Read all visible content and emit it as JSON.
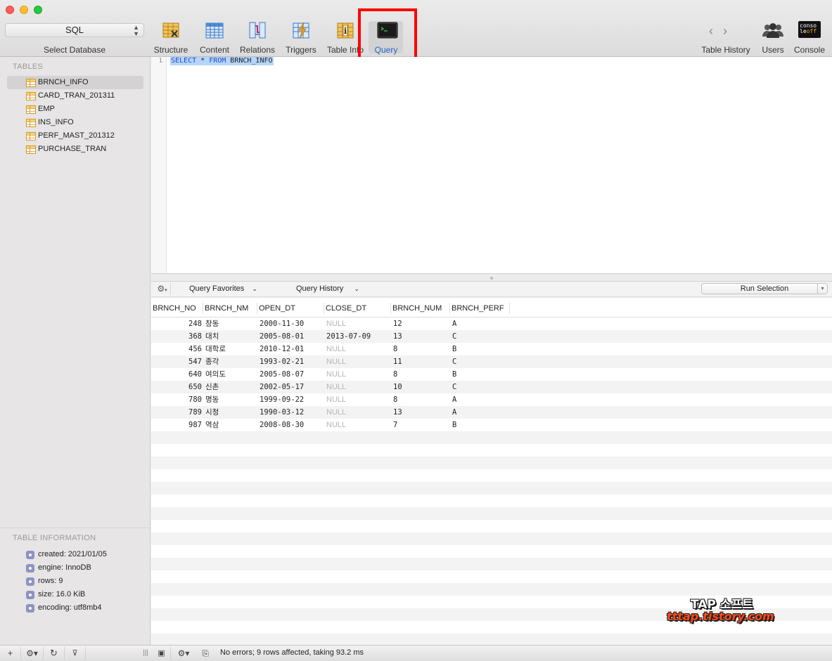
{
  "toolbar": {
    "database": {
      "value": "SQL",
      "label": "Select Database"
    },
    "buttons": {
      "structure": "Structure",
      "content": "Content",
      "relations": "Relations",
      "triggers": "Triggers",
      "table_info": "Table Info",
      "query": "Query",
      "table_history": "Table History",
      "users": "Users",
      "console": "Console"
    },
    "active": "query",
    "console_icon_text": [
      "conso",
      "le",
      "off"
    ]
  },
  "sidebar": {
    "tables_title": "TABLES",
    "tables": [
      {
        "name": "BRNCH_INFO",
        "selected": true
      },
      {
        "name": "CARD_TRAN_201311"
      },
      {
        "name": "EMP"
      },
      {
        "name": "INS_INFO"
      },
      {
        "name": "PERF_MAST_201312"
      },
      {
        "name": "PURCHASE_TRAN"
      }
    ],
    "info_title": "TABLE INFORMATION",
    "info": [
      "created: 2021/01/05",
      "engine: InnoDB",
      "rows: 9",
      "size: 16.0 KiB",
      "encoding: utf8mb4"
    ]
  },
  "editor": {
    "line_number": "1",
    "query": {
      "select": "SELECT",
      "star": " * ",
      "from": "FROM",
      "table": " BRNCH_INFO"
    }
  },
  "query_bar": {
    "favorites": "Query Favorites",
    "history": "Query History",
    "run": "Run Selection"
  },
  "results": {
    "columns": [
      "BRNCH_NO",
      "BRNCH_NM",
      "OPEN_DT",
      "CLOSE_DT",
      "BRNCH_NUM",
      "BRNCH_PERF"
    ],
    "rows": [
      [
        "248",
        "창동",
        "2000-11-30",
        "NULL",
        "12",
        "A"
      ],
      [
        "368",
        "대치",
        "2005-08-01",
        "2013-07-09",
        "13",
        "C"
      ],
      [
        "456",
        "대학로",
        "2010-12-01",
        "NULL",
        "8",
        "B"
      ],
      [
        "547",
        "종각",
        "1993-02-21",
        "NULL",
        "11",
        "C"
      ],
      [
        "640",
        "여의도",
        "2005-08-07",
        "NULL",
        "8",
        "B"
      ],
      [
        "650",
        "신촌",
        "2002-05-17",
        "NULL",
        "10",
        "C"
      ],
      [
        "780",
        "명동",
        "1999-09-22",
        "NULL",
        "8",
        "A"
      ],
      [
        "789",
        "시청",
        "1990-03-12",
        "NULL",
        "13",
        "A"
      ],
      [
        "987",
        "역삼",
        "2008-08-30",
        "NULL",
        "7",
        "B"
      ]
    ]
  },
  "status": "No errors; 9 rows affected, taking 93.2 ms",
  "watermark": {
    "line1": "TAP 소프트",
    "line2": "tttap.tistory.com"
  },
  "colors": {
    "accent": "#2566c9",
    "highlight": "#ff0000",
    "selection": "#b5d5fb"
  }
}
